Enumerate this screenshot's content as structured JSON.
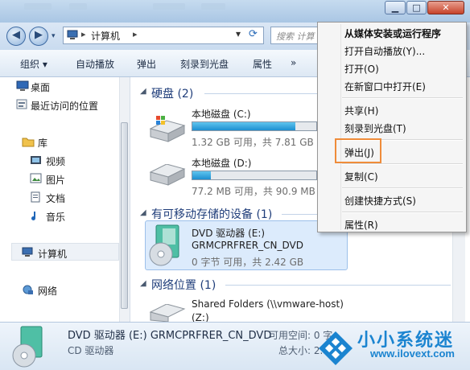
{
  "window": {
    "controls": {
      "minimize": "▁",
      "maximize": "□",
      "close": "✕"
    }
  },
  "address": {
    "back": "◀",
    "forward": "▶",
    "path_item": "计算机",
    "search_placeholder": "搜索 计算"
  },
  "toolbar": {
    "items": [
      "组织 ▾",
      "自动播放",
      "弹出",
      "刻录到光盘",
      "属性",
      "»"
    ]
  },
  "nav": {
    "favorites": [
      "桌面",
      "最近访问的位置"
    ],
    "library_label": "库",
    "libraries": [
      "视频",
      "图片",
      "文档",
      "音乐"
    ],
    "computer": "计算机",
    "network": "网络"
  },
  "main": {
    "hdd_group": "硬盘 (2)",
    "drives": [
      {
        "name": "本地磁盘 (C:)",
        "free": "1.32 GB 可用，共 7.81 GB",
        "used_fraction": 0.83
      },
      {
        "name": "本地磁盘 (D:)",
        "free": "77.2 MB 可用，共 90.9 MB",
        "used_fraction": 0.15
      }
    ],
    "removable_group": "有可移动存储的设备 (1)",
    "dvd": {
      "name": "DVD 驱动器 (E:)",
      "label": "GRMCPRFRER_CN_DVD",
      "free": "0 字节 可用，共 2.42 GB"
    },
    "network_group": "网络位置 (1)",
    "shared": {
      "name": "Shared Folders (\\\\vmware-host)",
      "letter": "(Z:)"
    }
  },
  "status": {
    "title": "DVD 驱动器 (E:) GRMCPRFRER_CN_DVD",
    "type": "CD 驱动器",
    "free_label": "可用空间: 0 字",
    "total_label": "总大小: 2.4"
  },
  "context_menu": {
    "items": [
      {
        "label": "从媒体安装或运行程序",
        "bold": true
      },
      {
        "label": "打开自动播放(Y)..."
      },
      {
        "label": "打开(O)"
      },
      {
        "label": "在新窗口中打开(E)"
      },
      {
        "label": "共享(H)"
      },
      {
        "label": "刻录到光盘(T)"
      },
      {
        "label": "弹出(J)"
      },
      {
        "label": "复制(C)"
      },
      {
        "label": "创建快捷方式(S)"
      },
      {
        "label": "属性(R)"
      }
    ]
  },
  "watermark": {
    "brand": "小小系统迷",
    "url": "www.ilovext.com"
  }
}
